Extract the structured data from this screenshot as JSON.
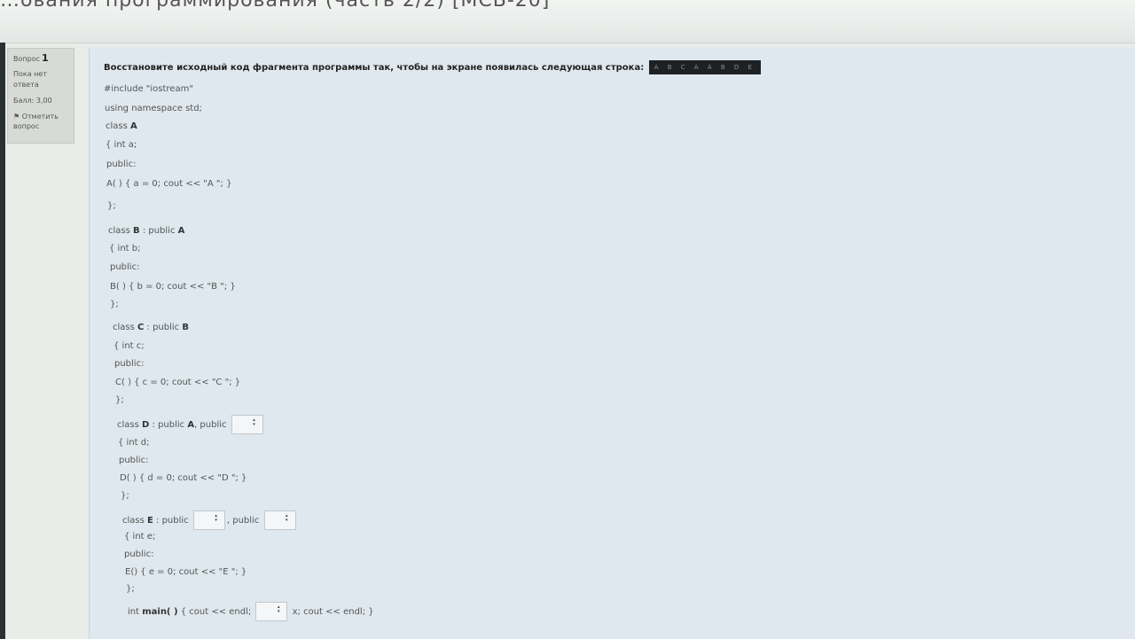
{
  "header": {
    "title": "…ования программирования (часть 2/2) [МСБ-20]"
  },
  "info": {
    "question_label": "Вопрос",
    "question_number": "1",
    "status": "Пока нет ответа",
    "score": "Балл: 3,00",
    "flag_label": "Отметить вопрос"
  },
  "question": {
    "text": "Восстановите исходный код фрагмента программы так, чтобы на экране появилась следующая строка:",
    "answer": "A B C A A B D E"
  },
  "code": {
    "l1": "#include \"iostream\"",
    "l2": "using namespace std;",
    "l3a": "class ",
    "l3b": "A",
    "l4": "{ int a;",
    "l5": "public:",
    "l6": "A( ) { a = 0; cout << \"A \"; }",
    "l7": "};",
    "l8a": "class ",
    "l8b": "B",
    "l8c": " : public ",
    "l8d": "A",
    "l9": "{ int b;",
    "l10": "public:",
    "l11": "B( ) { b = 0; cout << \"B \"; }",
    "l12": "};",
    "l13a": "class ",
    "l13b": "C",
    "l13c": " : public ",
    "l13d": "B",
    "l14": "{ int c;",
    "l15": "public:",
    "l16": "C( ) { c = 0; cout << \"C \"; }",
    "l17": "};",
    "l18a": "class ",
    "l18b": "D",
    "l18c": " : public ",
    "l18d": "A",
    "l18e": ",  public",
    "l19": "{ int d;",
    "l20": "public:",
    "l21": "D( ) { d = 0; cout << \"D \"; }",
    "l22": "};",
    "l23a": "class ",
    "l23b": "E",
    "l23c": " : public",
    "l23d": ", public",
    "l24": "{ int e;",
    "l25": "public:",
    "l26": "E() { e = 0; cout << \"E \"; }",
    "l27": "};",
    "l28a": "int ",
    "l28b": "main( )",
    "l28c": " { cout << endl;",
    "l28d": " x;  cout << endl; }"
  }
}
